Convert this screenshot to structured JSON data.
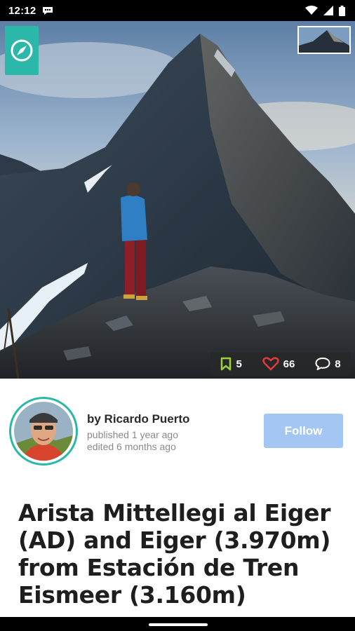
{
  "status_bar": {
    "time": "12:12"
  },
  "hero": {
    "stats": {
      "bookmarks": "5",
      "likes": "66",
      "comments": "8"
    }
  },
  "author": {
    "name": "by Ricardo Puerto",
    "published": "published 1 year ago",
    "edited": "edited 6 months ago",
    "follow_label": "Follow"
  },
  "article": {
    "title_lines": [
      "Arista Mittellegi al Eiger",
      "(AD) and Eiger (3.970m)",
      "from Estación de Tren",
      "Eismeer (3.160m)"
    ]
  },
  "colors": {
    "accent": "#2bb8a8",
    "follow_button": "#a4c6f2",
    "like_icon": "#e23b3b",
    "bookmark_icon": "#9bd23c"
  }
}
